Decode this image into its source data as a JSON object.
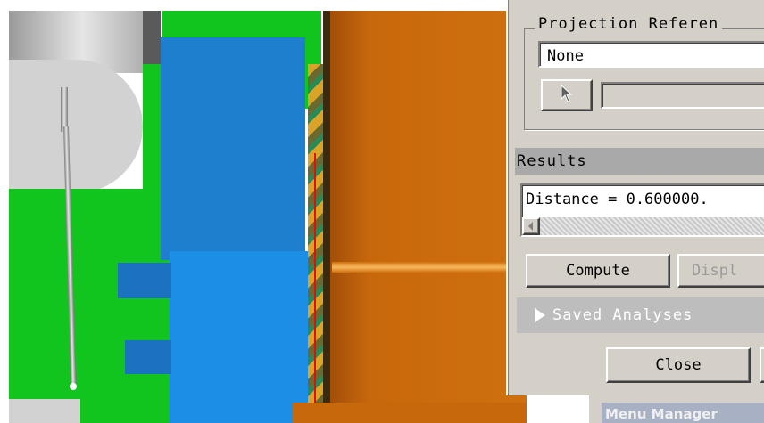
{
  "dialog": {
    "projection_reference": {
      "title": "Projection Referen",
      "value": "None"
    },
    "results": {
      "header": "Results",
      "distance_text": "Distance = 0.600000."
    },
    "buttons": {
      "compute": "Compute",
      "display": "Displ",
      "close": "Close"
    },
    "saved_analyses": {
      "label": "Saved Analyses",
      "icon": "expand-triangle-icon"
    },
    "pick_icon": "cursor-arrow-icon"
  },
  "menu_manager": {
    "title": "Menu Manager"
  },
  "colors": {
    "dialog_bg": "#d4d0c8",
    "viewport_green": "#12c41e",
    "viewport_blue": "#1f7fcf",
    "viewport_orange": "#c8680c",
    "viewport_gray": "#cfcfcf"
  }
}
